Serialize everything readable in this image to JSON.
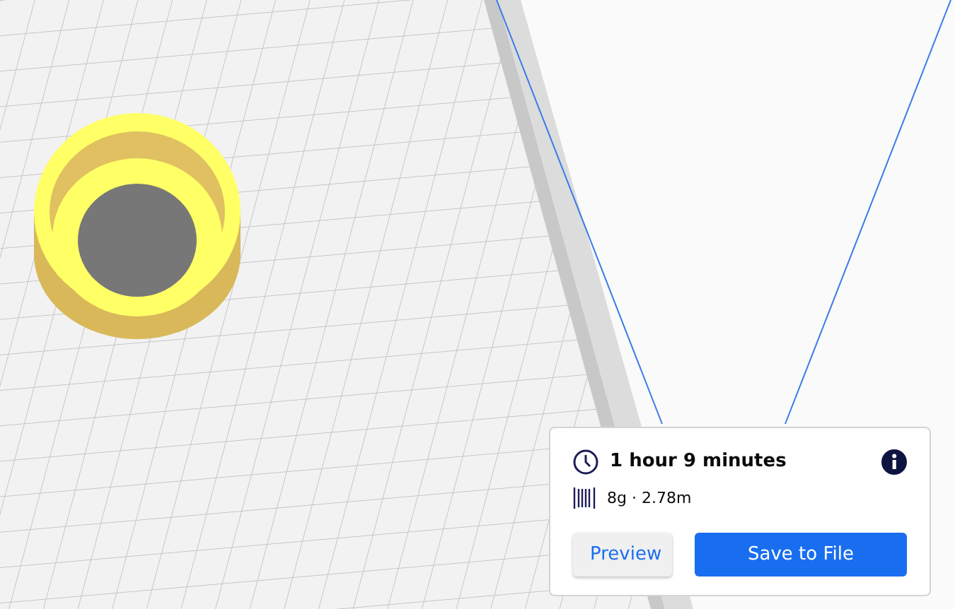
{
  "print_panel": {
    "print_time": "1 hour 9 minutes",
    "material": "8g · 2.78m",
    "buttons": [
      {
        "label": "Preview",
        "kind": "secondary"
      },
      {
        "label": "Save to File",
        "kind": "primary"
      }
    ]
  }
}
